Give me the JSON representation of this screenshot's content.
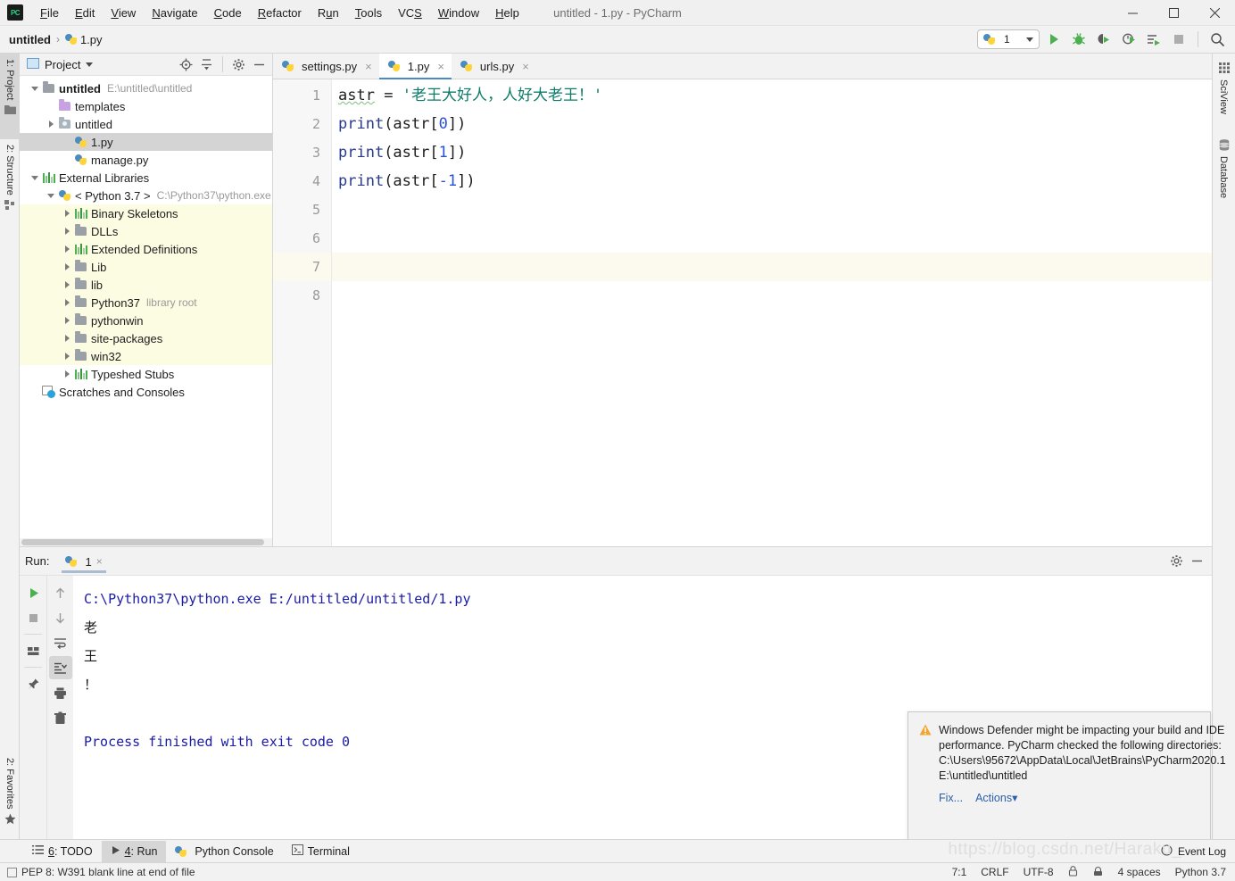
{
  "window": {
    "title": "untitled - 1.py - PyCharm",
    "logo_text": "PC",
    "minimize": "—",
    "maximize": "☐",
    "close": "✕"
  },
  "menu": [
    {
      "label": "File"
    },
    {
      "label": "Edit"
    },
    {
      "label": "View"
    },
    {
      "label": "Navigate"
    },
    {
      "label": "Code"
    },
    {
      "label": "Refactor"
    },
    {
      "label": "Run"
    },
    {
      "label": "Tools"
    },
    {
      "label": "VCS"
    },
    {
      "label": "Window"
    },
    {
      "label": "Help"
    }
  ],
  "breadcrumb": {
    "project": "untitled",
    "separator": "›",
    "file": "1.py"
  },
  "toolbar": {
    "run_config": "1",
    "icons": [
      "run-icon",
      "debug-icon",
      "coverage-icon",
      "profile-icon",
      "run-with-console-icon",
      "stop-icon",
      "search-everywhere-icon"
    ]
  },
  "left_tool_strip": [
    {
      "label": "1: Project",
      "icon": "project-icon",
      "active": true
    },
    {
      "label": "2: Structure",
      "icon": "structure-icon",
      "active": false
    },
    {
      "label": "2: Favorites",
      "icon": "star-icon",
      "active": false
    }
  ],
  "right_tool_strip": [
    {
      "label": "SciView",
      "icon": "sciview-grid-icon"
    },
    {
      "label": "Database",
      "icon": "database-icon"
    }
  ],
  "project_panel": {
    "title": "Project",
    "tools": [
      "locate-icon",
      "collapse-all-icon",
      "settings-gear-icon",
      "hide-icon"
    ],
    "tree": [
      {
        "indent": 0,
        "arrow": "open",
        "icon": "folder-icon",
        "name": "untitled",
        "bold": true,
        "path": "E:\\untitled\\untitled",
        "selected": false,
        "highlight": false
      },
      {
        "indent": 1,
        "arrow": "none",
        "icon": "folder-purple-icon",
        "name": "templates",
        "bold": false,
        "path": "",
        "selected": false,
        "highlight": false
      },
      {
        "indent": 1,
        "arrow": "closed",
        "icon": "folder-source-icon",
        "name": "untitled",
        "bold": false,
        "path": "",
        "selected": false,
        "highlight": false
      },
      {
        "indent": 2,
        "arrow": "none",
        "icon": "python-file-icon",
        "name": "1.py",
        "bold": false,
        "path": "",
        "selected": true,
        "highlight": false
      },
      {
        "indent": 2,
        "arrow": "none",
        "icon": "python-file-icon",
        "name": "manage.py",
        "bold": false,
        "path": "",
        "selected": false,
        "highlight": false
      },
      {
        "indent": 0,
        "arrow": "open",
        "icon": "library-bars-icon",
        "name": "External Libraries",
        "bold": false,
        "path": "",
        "selected": false,
        "highlight": false
      },
      {
        "indent": 1,
        "arrow": "open",
        "icon": "python-icon",
        "name": "< Python 3.7 >",
        "bold": false,
        "path": "C:\\Python37\\python.exe",
        "selected": false,
        "highlight": false
      },
      {
        "indent": 2,
        "arrow": "closed",
        "icon": "library-bars-icon",
        "name": "Binary Skeletons",
        "bold": false,
        "path": "",
        "selected": false,
        "highlight": true
      },
      {
        "indent": 2,
        "arrow": "closed",
        "icon": "folder-icon",
        "name": "DLLs",
        "bold": false,
        "path": "",
        "selected": false,
        "highlight": true
      },
      {
        "indent": 2,
        "arrow": "closed",
        "icon": "library-bars-icon",
        "name": "Extended Definitions",
        "bold": false,
        "path": "",
        "selected": false,
        "highlight": true
      },
      {
        "indent": 2,
        "arrow": "closed",
        "icon": "folder-icon",
        "name": "Lib",
        "bold": false,
        "path": "",
        "selected": false,
        "highlight": true
      },
      {
        "indent": 2,
        "arrow": "closed",
        "icon": "folder-icon",
        "name": "lib",
        "bold": false,
        "path": "",
        "selected": false,
        "highlight": true
      },
      {
        "indent": 2,
        "arrow": "closed",
        "icon": "folder-icon",
        "name": "Python37",
        "bold": false,
        "path": "library root",
        "selected": false,
        "highlight": true
      },
      {
        "indent": 2,
        "arrow": "closed",
        "icon": "folder-icon",
        "name": "pythonwin",
        "bold": false,
        "path": "",
        "selected": false,
        "highlight": true
      },
      {
        "indent": 2,
        "arrow": "closed",
        "icon": "folder-icon",
        "name": "site-packages",
        "bold": false,
        "path": "",
        "selected": false,
        "highlight": true
      },
      {
        "indent": 2,
        "arrow": "closed",
        "icon": "folder-icon",
        "name": "win32",
        "bold": false,
        "path": "",
        "selected": false,
        "highlight": true
      },
      {
        "indent": 2,
        "arrow": "closed",
        "icon": "library-bars-icon",
        "name": "Typeshed Stubs",
        "bold": false,
        "path": "",
        "selected": false,
        "highlight": false
      },
      {
        "indent": 0,
        "arrow": "none",
        "icon": "scratches-icon",
        "name": "Scratches and Consoles",
        "bold": false,
        "path": "",
        "selected": false,
        "highlight": false
      }
    ]
  },
  "editor": {
    "tabs": [
      {
        "label": "settings.py",
        "active": false
      },
      {
        "label": "1.py",
        "active": true
      },
      {
        "label": "urls.py",
        "active": false
      }
    ],
    "close_glyph": "×",
    "line_numbers": [
      "1",
      "2",
      "3",
      "4",
      "5",
      "6",
      "7",
      "8"
    ],
    "cursor_line": 7,
    "lines": [
      {
        "n": 1,
        "tokens": [
          {
            "t": "astr",
            "c": "var-squiggle"
          },
          {
            "t": " ",
            "c": "plain"
          },
          {
            "t": "=",
            "c": "op"
          },
          {
            "t": " ",
            "c": "plain"
          },
          {
            "t": "'老王大好人，人好大老王！'",
            "c": "string"
          }
        ]
      },
      {
        "n": 2,
        "tokens": [
          {
            "t": "print",
            "c": "func"
          },
          {
            "t": "(astr[",
            "c": "plain"
          },
          {
            "t": "0",
            "c": "number"
          },
          {
            "t": "])",
            "c": "plain"
          }
        ]
      },
      {
        "n": 3,
        "tokens": [
          {
            "t": "print",
            "c": "func"
          },
          {
            "t": "(astr[",
            "c": "plain"
          },
          {
            "t": "1",
            "c": "number"
          },
          {
            "t": "])",
            "c": "plain"
          }
        ]
      },
      {
        "n": 4,
        "tokens": [
          {
            "t": "print",
            "c": "func"
          },
          {
            "t": "(astr[",
            "c": "plain"
          },
          {
            "t": "-1",
            "c": "number"
          },
          {
            "t": "])",
            "c": "plain"
          }
        ]
      },
      {
        "n": 5,
        "tokens": []
      },
      {
        "n": 6,
        "tokens": []
      },
      {
        "n": 7,
        "tokens": []
      },
      {
        "n": 8,
        "tokens": []
      }
    ]
  },
  "run_panel": {
    "label": "Run:",
    "tab_label": "1",
    "tab_close": "×",
    "left_tools": [
      "rerun-icon",
      "stop-icon",
      "restore-layout-icon",
      "pin-tab-icon"
    ],
    "right_tools": [
      "up-arrow-icon",
      "down-arrow-icon",
      "soft-wrap-icon",
      "scroll-to-end-icon",
      "print-icon",
      "clear-all-icon"
    ],
    "header_tools": [
      "settings-gear-icon",
      "hide-icon"
    ],
    "console_lines": [
      {
        "text": "C:\\Python37\\python.exe E:/untitled/untitled/1.py",
        "cjk": false
      },
      {
        "text": "老",
        "cjk": true
      },
      {
        "text": "王",
        "cjk": true
      },
      {
        "text": "！",
        "cjk": true
      },
      {
        "text": "",
        "cjk": false
      },
      {
        "text": "Process finished with exit code 0",
        "cjk": false
      }
    ]
  },
  "notification": {
    "icon": "warning-icon",
    "message": "Windows Defender might be impacting your build and IDE performance. PyCharm checked the following directories:",
    "path1": "C:\\Users\\95672\\AppData\\Local\\JetBrains\\PyCharm2020.1",
    "path2": "E:\\untitled\\untitled",
    "fix_label": "Fix...",
    "actions_label": "Actions",
    "actions_caret": "▾"
  },
  "bottom_tabs": [
    {
      "label": "6: TODO",
      "icon": "todo-list-icon",
      "active": false
    },
    {
      "label": "4: Run",
      "icon": "run-icon",
      "active": true
    },
    {
      "label": "Python Console",
      "icon": "python-icon",
      "active": false
    },
    {
      "label": "Terminal",
      "icon": "terminal-icon",
      "active": false
    }
  ],
  "event_log": {
    "label": "Event Log",
    "icon": "event-log-icon"
  },
  "statusbar": {
    "inspection": "PEP 8: W391 blank line at end of file",
    "position": "7:1",
    "line_sep": "CRLF",
    "encoding": "UTF-8",
    "lock_icon": "lock-icon",
    "git_icon": "branch-icon",
    "indent": "4 spaces",
    "interpreter": "Python 3.7"
  },
  "watermark": "https://blog.csdn.net/Haraku_",
  "colors": {
    "accent_blue": "#4a89c8",
    "python_blue": "#4b8bbe",
    "python_yellow": "#ffd43b",
    "run_green": "#4caf50",
    "string_teal": "#0e7c6b",
    "number_blue": "#2a52d6",
    "console_blue": "#1a1aa8",
    "highlight_yellow": "#fcfce3",
    "selection_gray": "#d4d4d4"
  }
}
